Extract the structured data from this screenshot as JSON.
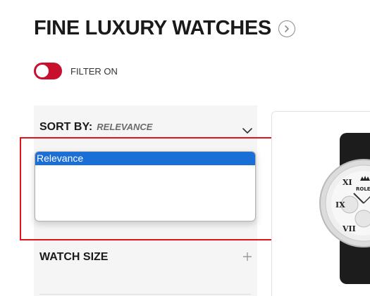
{
  "header": {
    "title": "FINE LUXURY WATCHES"
  },
  "filter": {
    "label": "FILTER ON",
    "toggle_on": true,
    "toggle_color": "#c8102e"
  },
  "sort": {
    "label": "SORT BY:",
    "selected_value": "RELEVANCE",
    "options": [
      "Relevance"
    ]
  },
  "facets": {
    "watch_size_label": "WATCH SIZE"
  },
  "product": {
    "brand_text": "ROLEX"
  },
  "icons": {
    "title_arrow": "chevron-right-circle-icon",
    "sort_toggle": "chevron-down-icon",
    "expand": "plus-icon"
  },
  "colors": {
    "accent_red": "#c8102e",
    "selection_blue": "#1a6fd6",
    "annotation_red": "#e0141c"
  }
}
